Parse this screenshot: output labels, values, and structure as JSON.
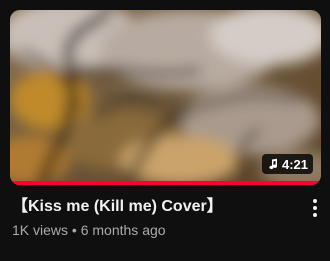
{
  "video": {
    "title": "【Kiss me (Kill me) Cover】",
    "views": "1K views",
    "separator": "•",
    "age": "6 months ago",
    "duration": "4:21",
    "duration_icon": "music-note-icon",
    "watched_fraction": 1.0
  },
  "menu": {
    "icon": "more-vert-icon"
  },
  "colors": {
    "background": "#0f0f0f",
    "progress": "#ff0033",
    "title": "#f1f1f1",
    "secondary": "#aaaaaa"
  }
}
